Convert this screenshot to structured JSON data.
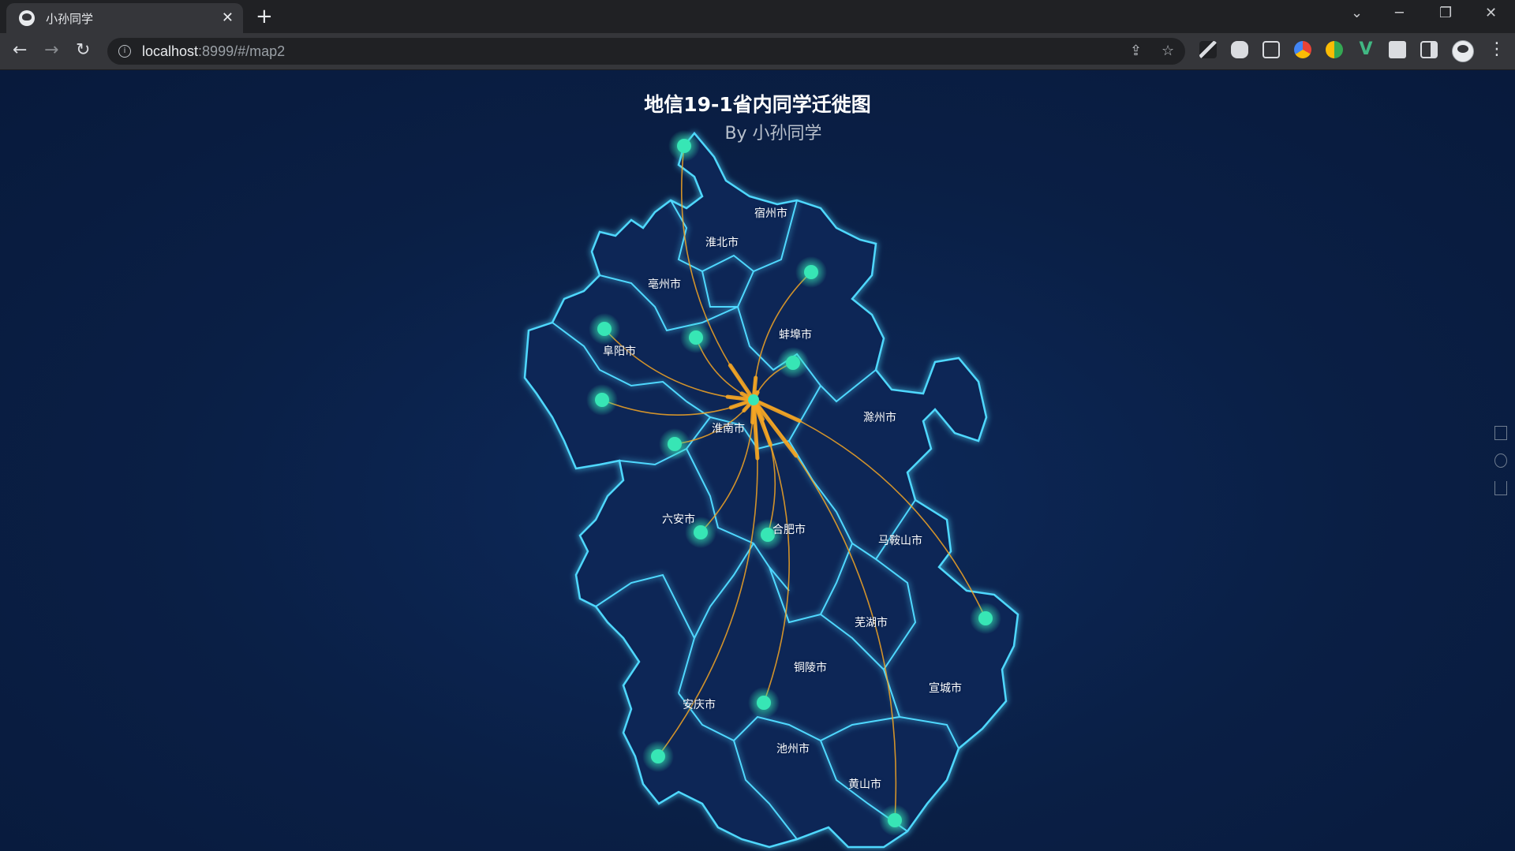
{
  "browser": {
    "tab_title": "小孙同学",
    "tab_close": "✕",
    "new_tab": "+",
    "url_host": "localhost",
    "url_rest": ":8999/#/map2",
    "back": "←",
    "forward": "→",
    "reload": "↻",
    "minimize": "─",
    "restore": "❐",
    "close": "✕",
    "tab_search": "⌄",
    "share_icon": "⇪",
    "star_icon": "☆",
    "menu": "⋮"
  },
  "map": {
    "title": "地信19-1省内同学迁徙图",
    "subtitle": "By 小孙同学",
    "colors": {
      "boundary": "#4fd8ff",
      "flow": "#f5a623",
      "point": "#37e6b5",
      "background": "#0a1f45"
    },
    "cities": [
      {
        "name": "宿州市"
      },
      {
        "name": "淮北市"
      },
      {
        "name": "亳州市"
      },
      {
        "name": "蚌埠市"
      },
      {
        "name": "阜阳市"
      },
      {
        "name": "淮南市"
      },
      {
        "name": "滁州市"
      },
      {
        "name": "六安市"
      },
      {
        "name": "合肥市"
      },
      {
        "name": "马鞍山市"
      },
      {
        "name": "芜湖市"
      },
      {
        "name": "铜陵市"
      },
      {
        "name": "宣城市"
      },
      {
        "name": "安庆市"
      },
      {
        "name": "池州市"
      },
      {
        "name": "黄山市"
      }
    ],
    "destination": "淮南市",
    "flows": [
      {
        "from": "宿州市",
        "to": "淮南市"
      },
      {
        "from": "蚌埠市",
        "to": "淮南市"
      },
      {
        "from": "蚌埠市",
        "to": "淮南市"
      },
      {
        "from": "阜阳市",
        "to": "淮南市"
      },
      {
        "from": "亳州市",
        "to": "淮南市"
      },
      {
        "from": "阜阳市",
        "to": "淮南市"
      },
      {
        "from": "六安市",
        "to": "淮南市"
      },
      {
        "from": "六安市",
        "to": "淮南市"
      },
      {
        "from": "合肥市",
        "to": "淮南市"
      },
      {
        "from": "宣城市",
        "to": "淮南市"
      },
      {
        "from": "安庆市",
        "to": "淮南市"
      },
      {
        "from": "池州市",
        "to": "淮南市"
      },
      {
        "from": "黄山市",
        "to": "淮南市"
      }
    ],
    "toolbox": [
      "data-view-icon",
      "restore-icon",
      "save-image-icon"
    ]
  }
}
